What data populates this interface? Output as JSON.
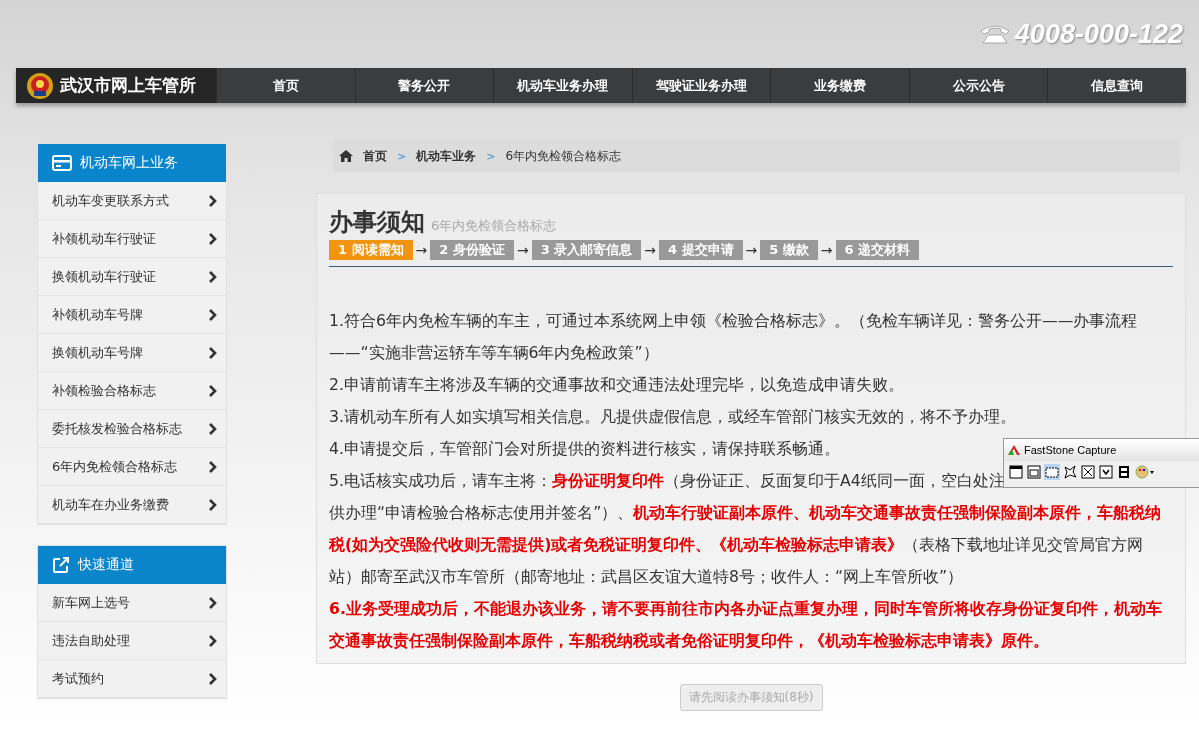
{
  "header": {
    "phone": "4008-000-122",
    "site_name": "武汉市网上车管所"
  },
  "nav": [
    {
      "label": "首页",
      "selected": false
    },
    {
      "label": "警务公开",
      "selected": false
    },
    {
      "label": "机动车业务办理",
      "selected": false
    },
    {
      "label": "驾驶证业务办理",
      "selected": false
    },
    {
      "label": "业务缴费",
      "selected": false
    },
    {
      "label": "公示公告",
      "selected": false
    },
    {
      "label": "信息查询",
      "selected": false
    }
  ],
  "sidebar": [
    {
      "title": "机动车网上业务",
      "kind": "card",
      "items": [
        "机动车变更联系方式",
        "补领机动车行驶证",
        "换领机动车行驶证",
        "补领机动车号牌",
        "换领机动车号牌",
        "补领检验合格标志",
        "委托核发检验合格标志",
        "6年内免检领合格标志",
        "机动车在办业务缴费"
      ]
    },
    {
      "title": "快速通道",
      "kind": "link",
      "items": [
        "新车网上选号",
        "违法自助处理",
        "考试预约"
      ]
    }
  ],
  "breadcrumb": [
    {
      "label": "首页",
      "link": true
    },
    {
      "label": "机动车业务",
      "link": true
    },
    {
      "label": "6年内免检领合格标志",
      "link": false
    }
  ],
  "breadcrumb_separator": ">",
  "notice": {
    "title": "办事须知",
    "subtitle": "6年内免检领合格标志",
    "steps": [
      {
        "label": "1 阅读需知",
        "selected": true
      },
      {
        "label": "2 身份验证",
        "selected": false
      },
      {
        "label": "3 录入邮寄信息",
        "selected": false
      },
      {
        "label": "4 提交申请",
        "selected": false
      },
      {
        "label": "5 缴款",
        "selected": false
      },
      {
        "label": "6 递交材料",
        "selected": false
      }
    ],
    "step_separator": "→",
    "paragraphs": [
      {
        "kind": "normal",
        "text": "1.符合6年内免检车辆的车主，可通过本系统网上申领《检验合格标志》。（免检车辆详见：警务公开——办事流程——“实施非营运轿车等车辆6年内免检政策”）"
      },
      {
        "kind": "normal",
        "text": "2.申请前请车主将涉及车辆的交通事故和交通违法处理完毕，以免造成申请失败。"
      },
      {
        "kind": "normal",
        "text": "3.请机动车所有人如实填写相关信息。凡提供虚假信息，或经车管部门核实无效的，将不予办理。"
      },
      {
        "kind": "normal",
        "text": "4.申请提交后，车管部门会对所提供的资料进行核实，请保持联系畅通。"
      },
      {
        "kind": "covered",
        "text": "5.电话核实成功后，请车主将：**身份证明复印件**（身份证正、反面复印于A4纸同一面，空白处注",
        "rest": "供办理“申请检验合格标志使用并签名”）、**机动车行驶证副本原件、机动车交通事故责任强制保险副本原件，车船税纳税(如为交强险代收则无需提供)或者免税证明复印件、《机动车检验标志申请表》**（表格下载地址详见交管局官方网站）邮寄至武汉市车管所（邮寄地址：武昌区友谊大道特8号；收件人：“网上车管所收”）"
      },
      {
        "kind": "alert",
        "text": "6.业务受理成功后，不能退办该业务，请不要再前往市内各办证点重复办理，同时车管所将收存身份证复印件，机动车交通事故责任强制保险副本原件，车船税纳税或者免俗证明复印件，《机动车检验标志申请表》原件。"
      }
    ],
    "button": {
      "label": "请先阅读办事须知(8秒)",
      "disabled": true
    }
  },
  "capture_toolbar": {
    "title": "FastStone Capture"
  }
}
